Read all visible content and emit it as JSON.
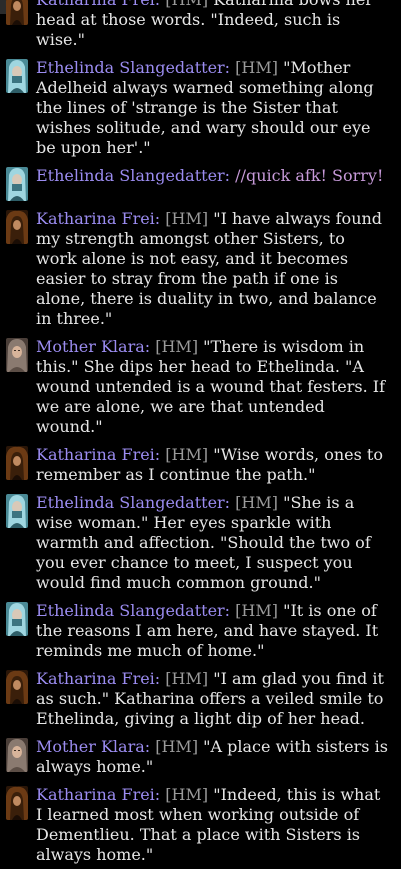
{
  "top_fragment": "... ... ...",
  "messages": [
    {
      "avatar": "katharina",
      "speaker": "Katharina Frei:",
      "tag": "[HM]",
      "text": "Katharina bows her head at those words. \"Indeed, such is wise.\"",
      "style": "normal"
    },
    {
      "avatar": "ethelinda",
      "speaker": "Ethelinda Slangedatter:",
      "tag": "[HM]",
      "text": "\"Mother Adelheid always warned something along the lines of 'strange is the Sister that wishes solitude, and wary should our eye be upon her'.\"",
      "style": "normal"
    },
    {
      "avatar": "ethelinda",
      "speaker": "Ethelinda Slangedatter:",
      "tag": "",
      "text": "//quick afk! Sorry!",
      "style": "ooc"
    },
    {
      "avatar": "katharina",
      "speaker": "Katharina Frei:",
      "tag": "[HM]",
      "text": "\"I have always found my strength amongst other Sisters, to work alone is not easy, and it becomes easier to stray from the path if one is alone, there is duality in two, and balance in three.\"",
      "style": "normal"
    },
    {
      "avatar": "klara",
      "speaker": "Mother Klara:",
      "tag": "[HM]",
      "text": "\"There is wisdom in this.\" She dips her head to Ethelinda. \"A wound untended is a wound that festers. If we are alone, we are that untended wound.\"",
      "style": "normal"
    },
    {
      "avatar": "katharina",
      "speaker": "Katharina Frei:",
      "tag": "[HM]",
      "text": "\"Wise words, ones to remember as I continue the path.\"",
      "style": "normal"
    },
    {
      "avatar": "ethelinda",
      "speaker": "Ethelinda Slangedatter:",
      "tag": "[HM]",
      "text": "\"She is a wise woman.\" Her eyes sparkle with warmth and affection. \"Should the two of you ever chance to meet, I suspect you would find much common ground.\"",
      "style": "normal"
    },
    {
      "avatar": "ethelinda",
      "speaker": "Ethelinda Slangedatter:",
      "tag": "[HM]",
      "text": "\"It is one of the reasons I am here, and have stayed. It reminds me much of home.\"",
      "style": "normal"
    },
    {
      "avatar": "katharina",
      "speaker": "Katharina Frei:",
      "tag": "[HM]",
      "text": "\"I am glad you find it as such.\" Katharina offers a veiled smile to Ethelinda, giving a light dip of her head.",
      "style": "normal"
    },
    {
      "avatar": "klara",
      "speaker": "Mother Klara:",
      "tag": "[HM]",
      "text": "\"A place with sisters is always home.\"",
      "style": "normal"
    },
    {
      "avatar": "katharina",
      "speaker": "Katharina Frei:",
      "tag": "[HM]",
      "text": "\"Indeed, this is what I learned most when working outside of Dementlieu. That a place with Sisters is always home.\"",
      "style": "normal"
    }
  ],
  "colors": {
    "background": "#000000",
    "speaker": "#9b8cf0",
    "tag": "#9a9a9a",
    "ooc": "#c79ad9",
    "text": "#e6e6e6"
  }
}
